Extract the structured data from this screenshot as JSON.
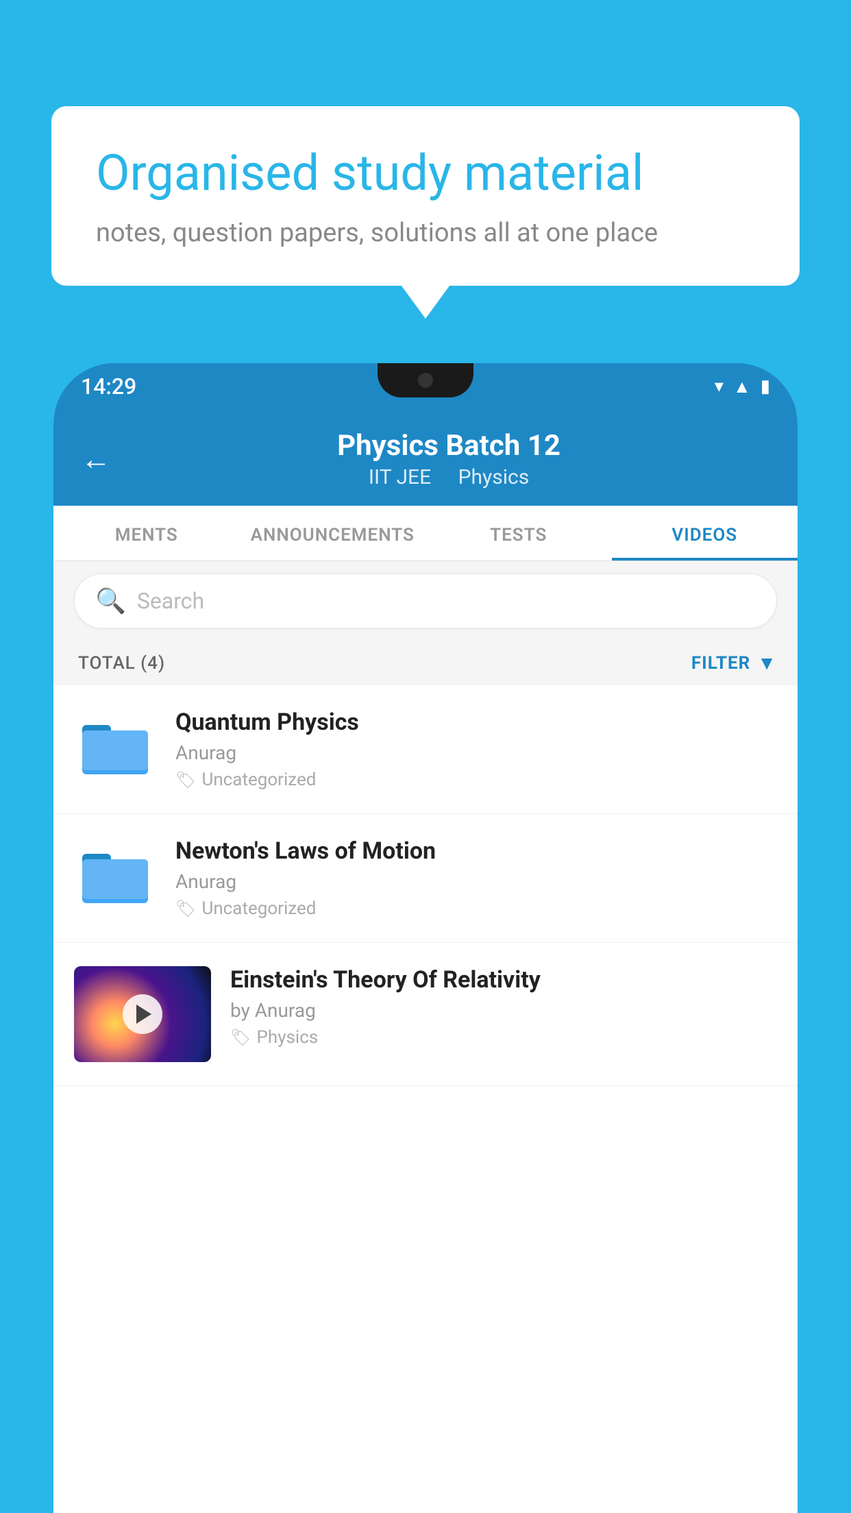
{
  "background_color": "#29B6E8",
  "bubble": {
    "title": "Organised study material",
    "subtitle": "notes, question papers, solutions all at one place"
  },
  "phone": {
    "status_bar": {
      "time": "14:29",
      "icons": [
        "wifi",
        "signal",
        "battery"
      ]
    },
    "header": {
      "back_label": "←",
      "title": "Physics Batch 12",
      "subtitle_part1": "IIT JEE",
      "subtitle_part2": "Physics"
    },
    "tabs": [
      {
        "label": "MENTS",
        "active": false
      },
      {
        "label": "ANNOUNCEMENTS",
        "active": false
      },
      {
        "label": "TESTS",
        "active": false
      },
      {
        "label": "VIDEOS",
        "active": true
      }
    ],
    "search": {
      "placeholder": "Search"
    },
    "filter_bar": {
      "total_label": "TOTAL (4)",
      "filter_label": "FILTER"
    },
    "videos": [
      {
        "id": 1,
        "title": "Quantum Physics",
        "author": "Anurag",
        "tag": "Uncategorized",
        "type": "folder",
        "has_thumbnail": false
      },
      {
        "id": 2,
        "title": "Newton's Laws of Motion",
        "author": "Anurag",
        "tag": "Uncategorized",
        "type": "folder",
        "has_thumbnail": false
      },
      {
        "id": 3,
        "title": "Einstein's Theory Of Relativity",
        "author": "by Anurag",
        "tag": "Physics",
        "type": "video",
        "has_thumbnail": true
      }
    ]
  }
}
